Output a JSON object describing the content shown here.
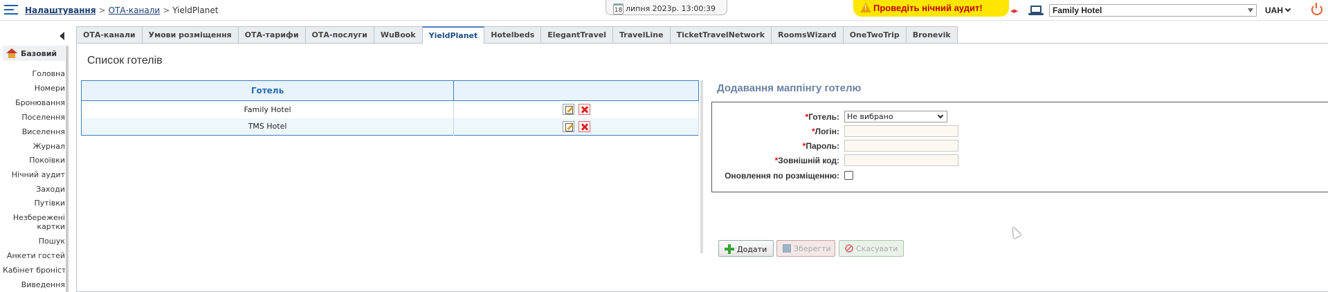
{
  "breadcrumb": {
    "root": "Налаштування",
    "section": "ОТА-канали",
    "current": "YieldPlanet",
    "sep": ">"
  },
  "datetime": {
    "day": "18",
    "text": "липня 2023р.  13:00:39"
  },
  "audit": {
    "label": "Проведіть нічний аудит!"
  },
  "arrows": "◂▸",
  "hotel_selector": {
    "value": "Family Hotel"
  },
  "currency": {
    "value": "UAH"
  },
  "sidebar": {
    "section": "Базовий",
    "items": [
      "Головна",
      "Номери",
      "Бронювання",
      "Поселення",
      "Виселення",
      "Журнал",
      "Покоївки",
      "Нічний аудит",
      "Заходи",
      "Путівки",
      "Незбережені",
      "картки",
      "Пошук",
      "Анкети гостей",
      "Кабінет броніста",
      "Виведення"
    ]
  },
  "tabs": [
    "ОТА-канали",
    "Умови розміщення",
    "ОТА-тарифи",
    "ОТА-послуги",
    "WuBook",
    "YieldPlanet",
    "Hotelbeds",
    "ElegantTravel",
    "TravelLine",
    "TicketTravelNetwork",
    "RoomsWizard",
    "OneTwoTrip",
    "Bronevik"
  ],
  "active_tab": "YieldPlanet",
  "hotels": {
    "title": "Список готелів",
    "column": "Готель",
    "rows": [
      "Family Hotel",
      "TMS Hotel"
    ]
  },
  "form": {
    "title": "Додавання маппінгу готелю",
    "required_mark": "*",
    "hotel_label": "Готель:",
    "hotel_value": "Не вибрано",
    "login_label": "Логін:",
    "password_label": "Пароль:",
    "external_code_label": "Зовнішній код:",
    "update_label": "Оновлення по розміщенню:",
    "add_button": "Додати",
    "save_button": "Зберегти",
    "cancel_button": "Скасувати"
  },
  "colors": {
    "accent": "#2a6fb0",
    "audit_bg": "#ffe600",
    "audit_text": "#c00000",
    "required": "#e00000"
  }
}
